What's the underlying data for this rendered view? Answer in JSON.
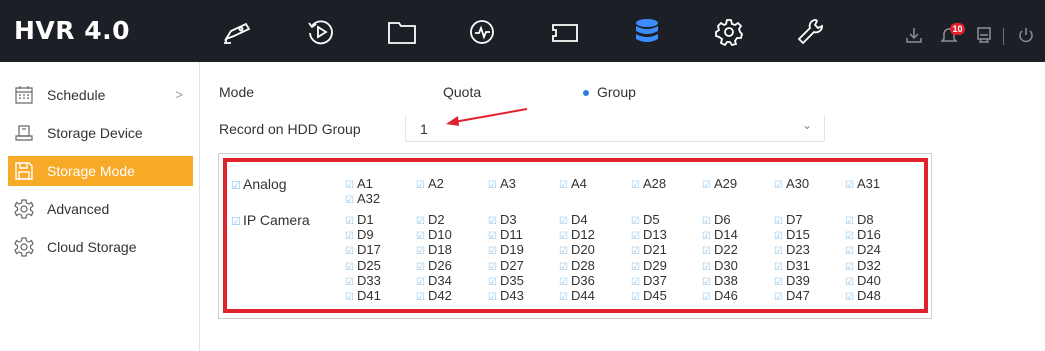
{
  "app": {
    "title": "HVR 4.0"
  },
  "top_nav": [
    {
      "name": "live-view-camera-icon"
    },
    {
      "name": "playback-icon"
    },
    {
      "name": "file-management-icon"
    },
    {
      "name": "smart-analysis-icon"
    },
    {
      "name": "configuration-icon"
    },
    {
      "name": "storage-icon",
      "active": true
    },
    {
      "name": "system-settings-gear-icon"
    },
    {
      "name": "maintenance-wrench-icon"
    }
  ],
  "utility": {
    "alarm_count": "10"
  },
  "sidebar": {
    "items": [
      {
        "label": "Schedule",
        "icon": "calendar-icon"
      },
      {
        "label": "Storage Device",
        "icon": "hdd-icon"
      },
      {
        "label": "Storage Mode",
        "icon": "save-icon",
        "active": true
      },
      {
        "label": "Advanced",
        "icon": "gear-icon"
      },
      {
        "label": "Cloud Storage",
        "icon": "gear-icon"
      }
    ]
  },
  "form": {
    "mode_label": "Mode",
    "quota_label": "Quota",
    "group_label": "Group",
    "selected_mode": "Group",
    "record_label": "Record on HDD Group",
    "hdd_group_value": "1"
  },
  "channels": {
    "analog_label": "Analog",
    "ip_camera_label": "IP Camera",
    "analog": [
      "A1",
      "A2",
      "A3",
      "A4",
      "A28",
      "A29",
      "A30",
      "A31",
      "A32"
    ],
    "ip": [
      "D1",
      "D2",
      "D3",
      "D4",
      "D5",
      "D6",
      "D7",
      "D8",
      "D9",
      "D10",
      "D11",
      "D12",
      "D13",
      "D14",
      "D15",
      "D16",
      "D17",
      "D18",
      "D19",
      "D20",
      "D21",
      "D22",
      "D23",
      "D24",
      "D25",
      "D26",
      "D27",
      "D28",
      "D29",
      "D30",
      "D31",
      "D32",
      "D33",
      "D34",
      "D35",
      "D36",
      "D37",
      "D38",
      "D39",
      "D40",
      "D41",
      "D42",
      "D43",
      "D44",
      "D45",
      "D46",
      "D47",
      "D48"
    ]
  },
  "colors": {
    "topbar_bg": "#1c1f25",
    "accent_active": "#f7a928",
    "nav_active": "#3d8bff",
    "annotation_red": "#e0222e",
    "checkbox": "#8fc5ea"
  }
}
